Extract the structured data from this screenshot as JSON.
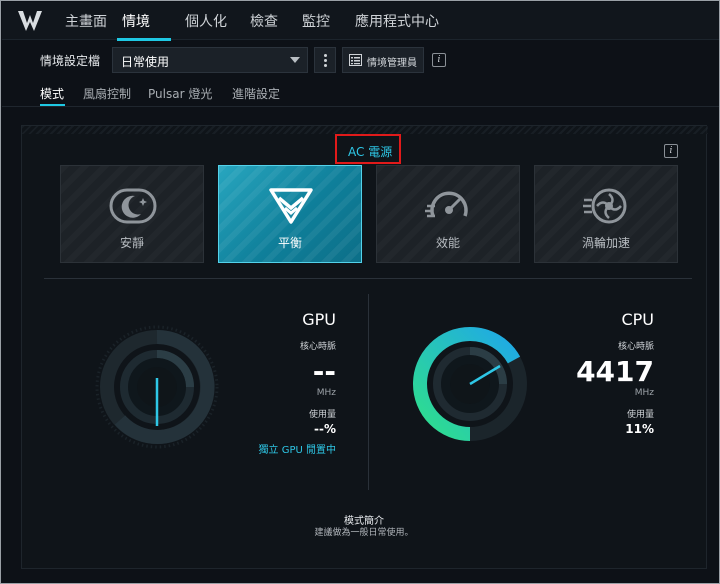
{
  "nav": {
    "tabs": [
      {
        "label": "主畫面"
      },
      {
        "label": "情境"
      },
      {
        "label": "個人化"
      },
      {
        "label": "檢查"
      },
      {
        "label": "監控"
      },
      {
        "label": "應用程式中心"
      }
    ],
    "active_tab": "情境"
  },
  "profile": {
    "label": "情境設定檔",
    "selected": "日常使用",
    "manager_label": "情境管理員",
    "info_icon": "info-icon"
  },
  "subtabs": {
    "items": [
      {
        "label": "模式"
      },
      {
        "label": "風扇控制"
      },
      {
        "label": "Pulsar 燈光"
      },
      {
        "label": "進階設定"
      }
    ],
    "active": "模式"
  },
  "power": {
    "label": "AC 電源"
  },
  "modes": [
    {
      "label": "安靜",
      "icon": "moon-icon",
      "active": false
    },
    {
      "label": "平衡",
      "icon": "balance-icon",
      "active": true
    },
    {
      "label": "效能",
      "icon": "speedometer-icon",
      "active": false
    },
    {
      "label": "渦輪加速",
      "icon": "turbo-fan-icon",
      "active": false
    }
  ],
  "gpu": {
    "title": "GPU",
    "clock_label": "核心時脈",
    "clock_value": "--",
    "clock_unit": "MHz",
    "usage_label": "使用量",
    "usage_value": "--%",
    "status": "獨立 GPU 閒置中"
  },
  "cpu": {
    "title": "CPU",
    "clock_label": "核心時脈",
    "clock_value": "4417",
    "clock_unit": "MHz",
    "usage_label": "使用量",
    "usage_value": "11%"
  },
  "brief": {
    "title": "模式簡介",
    "description": "建議做為一般日常使用。"
  },
  "colors": {
    "accent": "#1fc8e3",
    "highlight_box": "#e11a1a",
    "gauge_green": "#2fe08a",
    "gauge_blue": "#1fa8e8"
  }
}
